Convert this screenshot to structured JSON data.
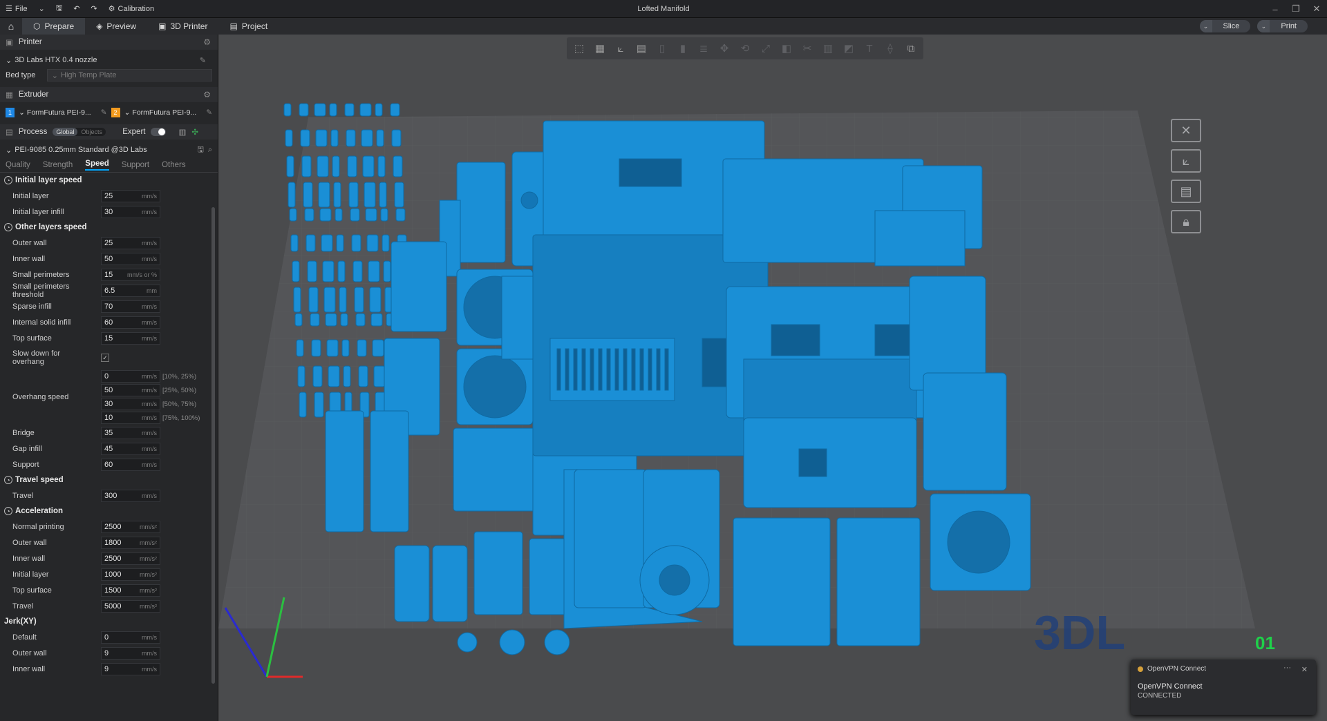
{
  "titlebar": {
    "file_label": "File",
    "calibration_label": "Calibration",
    "window_title": "Lofted Manifold"
  },
  "tabs": [
    {
      "label": "Prepare"
    },
    {
      "label": "Preview"
    },
    {
      "label": "3D Printer"
    },
    {
      "label": "Project"
    }
  ],
  "actions": {
    "slice": "Slice",
    "print": "Print"
  },
  "printer": {
    "section": "Printer",
    "preset": "3D Labs HTX 0.4 nozzle",
    "bed_type_label": "Bed type",
    "bed_type_value": "High Temp Plate"
  },
  "extruder": {
    "section": "Extruder",
    "filaments": [
      {
        "index": "1",
        "name": "FormFutura PEI-9...",
        "color": "#1e88e5"
      },
      {
        "index": "2",
        "name": "FormFutura PEI-9...",
        "color": "#f29b1f"
      }
    ]
  },
  "process": {
    "section": "Process",
    "global_label": "Global",
    "objects_label": "Objects",
    "expert_label": "Expert",
    "preset": "PEI-9085 0.25mm Standard @3D Labs",
    "subtabs": [
      "Quality",
      "Strength",
      "Speed",
      "Support",
      "Others"
    ],
    "active_subtab": "Speed"
  },
  "groups": {
    "initial": "Initial layer speed",
    "other": "Other layers speed",
    "travel": "Travel speed",
    "accel": "Acceleration",
    "jerk": "Jerk(XY)"
  },
  "initial_fields": [
    {
      "label": "Initial layer",
      "value": "25",
      "unit": "mm/s"
    },
    {
      "label": "Initial layer infill",
      "value": "30",
      "unit": "mm/s"
    }
  ],
  "other_fields": [
    {
      "label": "Outer wall",
      "value": "25",
      "unit": "mm/s"
    },
    {
      "label": "Inner wall",
      "value": "50",
      "unit": "mm/s"
    },
    {
      "label": "Small perimeters",
      "value": "15",
      "unit": "mm/s or %"
    },
    {
      "label": "Small perimeters threshold",
      "value": "6.5",
      "unit": "mm"
    },
    {
      "label": "Sparse infill",
      "value": "70",
      "unit": "mm/s"
    },
    {
      "label": "Internal solid infill",
      "value": "60",
      "unit": "mm/s"
    },
    {
      "label": "Top surface",
      "value": "15",
      "unit": "mm/s"
    }
  ],
  "slowdown_label": "Slow down for overhang",
  "overhang": {
    "label": "Overhang speed",
    "rows": [
      {
        "value": "0",
        "unit": "mm/s",
        "range": "[10%, 25%)"
      },
      {
        "value": "50",
        "unit": "mm/s",
        "range": "[25%, 50%)"
      },
      {
        "value": "30",
        "unit": "mm/s",
        "range": "[50%, 75%)"
      },
      {
        "value": "10",
        "unit": "mm/s",
        "range": "[75%, 100%)"
      }
    ]
  },
  "other_fields_2": [
    {
      "label": "Bridge",
      "value": "35",
      "unit": "mm/s"
    },
    {
      "label": "Gap infill",
      "value": "45",
      "unit": "mm/s"
    },
    {
      "label": "Support",
      "value": "60",
      "unit": "mm/s"
    }
  ],
  "travel_fields": [
    {
      "label": "Travel",
      "value": "300",
      "unit": "mm/s"
    }
  ],
  "accel_fields": [
    {
      "label": "Normal printing",
      "value": "2500",
      "unit": "mm/s²"
    },
    {
      "label": "Outer wall",
      "value": "1800",
      "unit": "mm/s²"
    },
    {
      "label": "Inner wall",
      "value": "2500",
      "unit": "mm/s²"
    },
    {
      "label": "Initial layer",
      "value": "1000",
      "unit": "mm/s²"
    },
    {
      "label": "Top surface",
      "value": "1500",
      "unit": "mm/s²"
    },
    {
      "label": "Travel",
      "value": "5000",
      "unit": "mm/s²"
    }
  ],
  "jerk_fields": [
    {
      "label": "Default",
      "value": "0",
      "unit": "mm/s"
    },
    {
      "label": "Outer wall",
      "value": "9",
      "unit": "mm/s"
    },
    {
      "label": "Inner wall",
      "value": "9",
      "unit": "mm/s"
    }
  ],
  "viewport": {
    "plate_number": "01",
    "model_color": "#1a8fd6",
    "plate_logo": "3DL"
  },
  "toast": {
    "app": "OpenVPN Connect",
    "title": "OpenVPN Connect",
    "status": "CONNECTED"
  }
}
